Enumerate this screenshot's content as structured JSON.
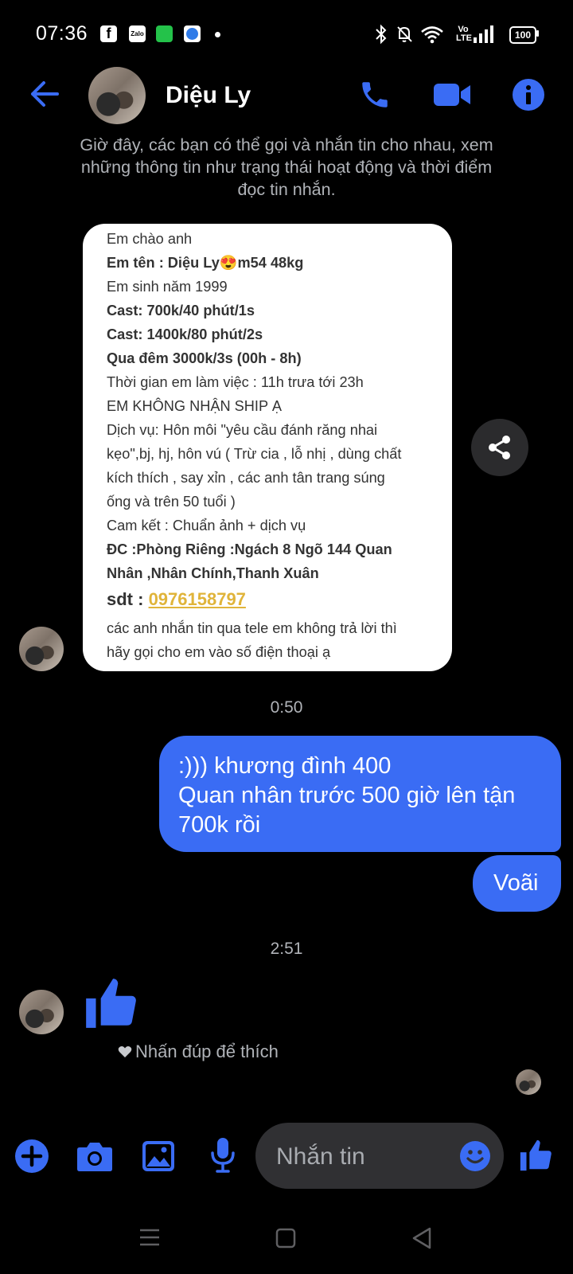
{
  "status_bar": {
    "time": "07:36",
    "notification_icons": [
      "facebook-icon",
      "zalo-icon",
      "wechat-icon",
      "browser-icon"
    ],
    "battery": "100",
    "network_label": "Vo LTE"
  },
  "header": {
    "contact_name": "Diệu Ly",
    "icons": [
      "back-arrow-icon",
      "phone-icon",
      "video-camera-icon",
      "info-icon"
    ]
  },
  "system_notice": "Giờ đây, các bạn có thể gọi và nhắn tin cho nhau, xem những thông tin như trạng thái hoạt động và thời điểm đọc tin nhắn.",
  "image_card": {
    "lines": [
      "Em chào anh",
      "Em tên : Diệu Ly",
      "m54 48kg",
      "Em sinh năm 1999",
      "Cast: 700k/40 phút/1s",
      "Cast: 1400k/80 phút/2s",
      "Qua đêm 3000k/3s (00h - 8h)",
      "Thời gian em làm việc : 11h trưa tới 23h",
      "EM KHÔNG NHẬN SHIP Ạ",
      "Dịch vụ: Hôn môi \"yêu cầu đánh răng nhai",
      "kẹo\",bj, hj, hôn vú ( Trừ cia , lỗ nhị , dùng chất",
      "kích thích , say xỉn , các anh tân trang súng",
      "ống và trên 50 tuổi )",
      "Cam kết : Chuẩn ảnh + dịch vụ",
      "ĐC  :Phòng Riêng :Ngách 8 Ngõ 144 Quan",
      "Nhân ,Nhân Chính,Thanh Xuân",
      "sdt : ",
      "0976158797",
      "các anh nhắn tin qua tele em không trả lời thì",
      "hãy gọi cho em vào số điện thoại ạ"
    ],
    "emoji": "😍"
  },
  "messages": {
    "timestamp_1": "0:50",
    "sent_1": ":))) khương đình 400\nQuan nhân trước 500 giờ lên tận 700k rồi",
    "sent_2": "Voãi",
    "timestamp_2": "2:51",
    "received_like": "thumbs-up-icon",
    "like_hint": "Nhấn đúp để thích"
  },
  "composer": {
    "placeholder": "Nhắn tin",
    "icons": [
      "plus-icon",
      "camera-icon",
      "gallery-icon",
      "microphone-icon",
      "emoji-icon",
      "thumbs-up-icon"
    ]
  },
  "colors": {
    "accent": "#3a6cf4",
    "background": "#000000",
    "link_yellow": "#e0b43a"
  }
}
